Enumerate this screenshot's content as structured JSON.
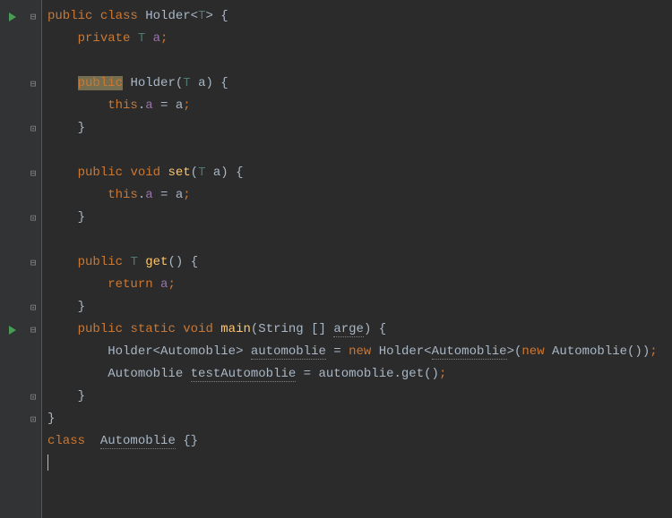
{
  "code": {
    "l1": {
      "public": "public",
      "class": "class",
      "name": "Holder",
      "tp": "T"
    },
    "l2": {
      "private": "private",
      "tp": "T",
      "var": "a"
    },
    "l4": {
      "public": "public",
      "name": "Holder",
      "tp": "T",
      "param": "a"
    },
    "l5": {
      "this": "this",
      "field": "a",
      "rhs": "a"
    },
    "l8": {
      "public": "public",
      "void": "void",
      "name": "set",
      "tp": "T",
      "param": "a"
    },
    "l9": {
      "this": "this",
      "field": "a",
      "rhs": "a"
    },
    "l12": {
      "public": "public",
      "tp": "T",
      "name": "get"
    },
    "l13": {
      "return": "return",
      "var": "a"
    },
    "l15": {
      "public": "public",
      "static": "static",
      "void": "void",
      "name": "main",
      "argtype": "String",
      "argname": "arge"
    },
    "l16": {
      "holder": "Holder",
      "automoblie": "Automoblie",
      "var": "automoblie",
      "new": "new",
      "holder2": "Holder",
      "automoblie2": "Automoblie",
      "new2": "new",
      "ctor": "Automoblie"
    },
    "l17": {
      "type": "Automoblie",
      "var": "testAutomoblie",
      "obj": "automoblie",
      "method": "get"
    },
    "l20": {
      "class": "class",
      "name": "Automoblie"
    }
  }
}
